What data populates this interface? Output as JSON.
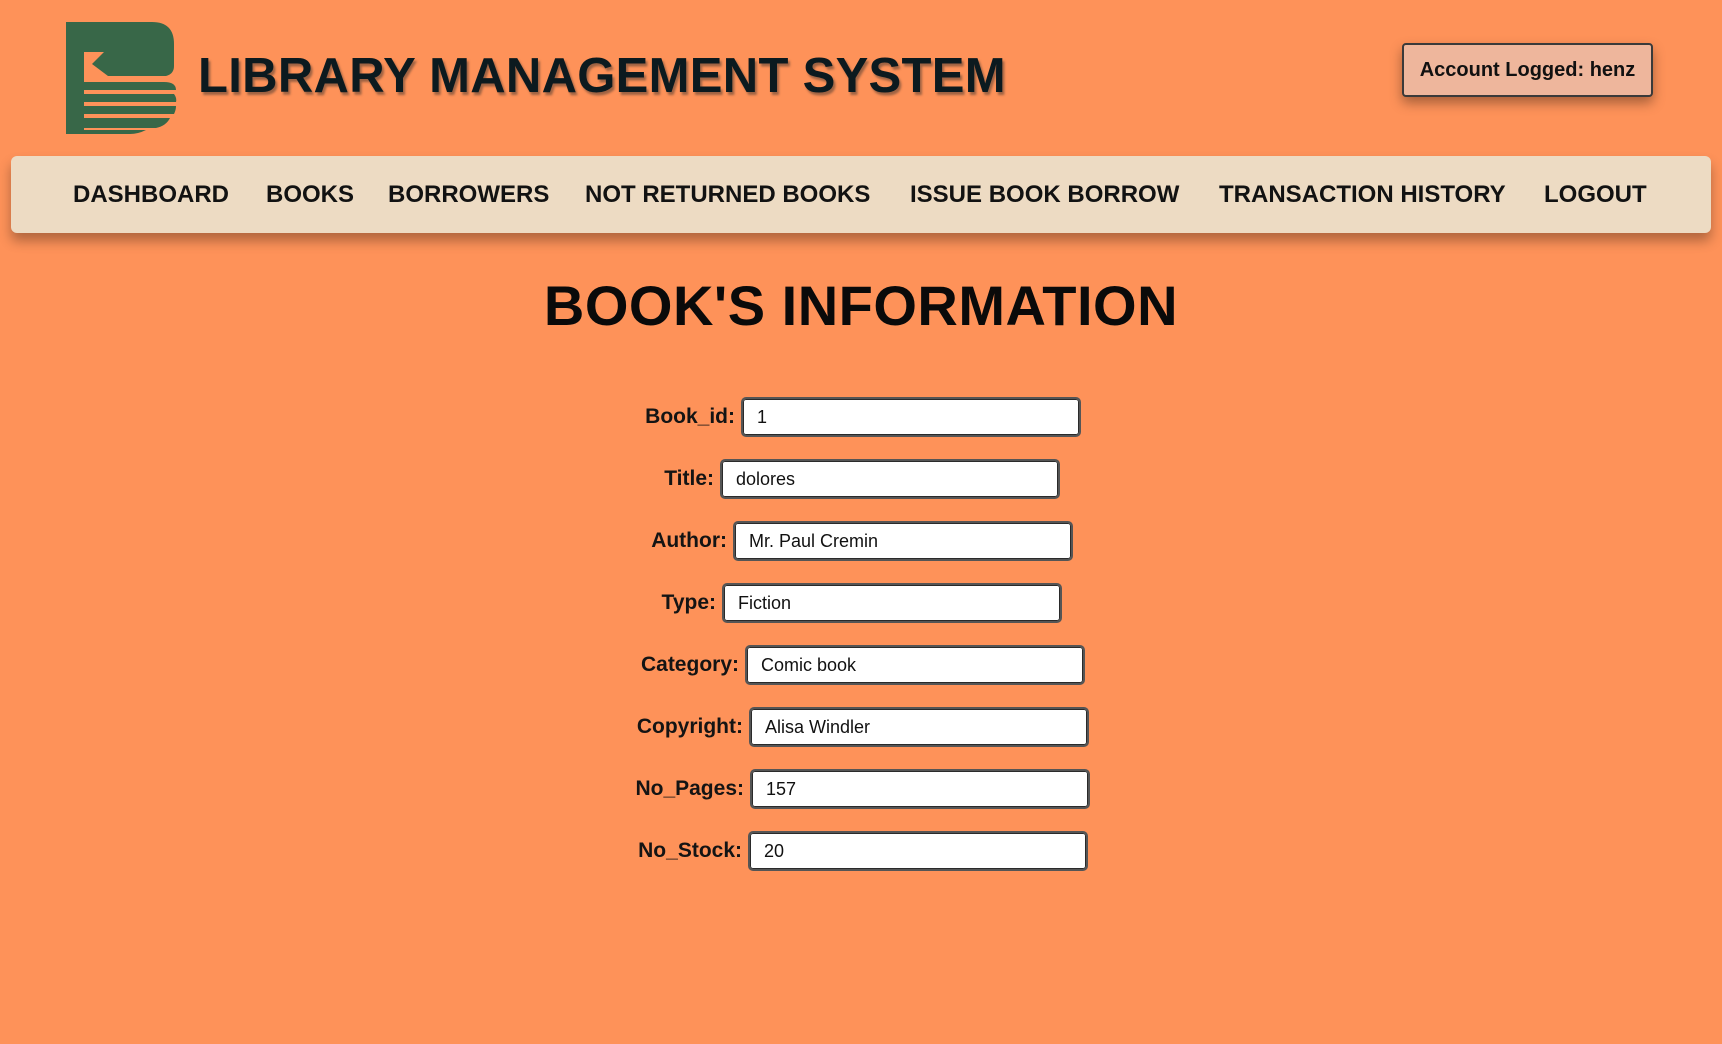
{
  "header": {
    "logo_icon": "book-stack-logo-icon",
    "title": "LIBRARY MANAGEMENT SYSTEM",
    "account_label": "Account Logged: henz"
  },
  "colors": {
    "background": "#fe9259",
    "navbar": "#eddbc3",
    "logo": "#386748",
    "account_badge": "#eeb69c"
  },
  "nav": {
    "items": [
      {
        "label": "DASHBOARD"
      },
      {
        "label": "BOOKS"
      },
      {
        "label": "BORROWERS"
      },
      {
        "label": "NOT RETURNED BOOKS"
      },
      {
        "label": "ISSUE BOOK BORROW"
      },
      {
        "label": "TRANSACTION HISTORY"
      },
      {
        "label": "LOGOUT"
      }
    ]
  },
  "page": {
    "title": "BOOK'S INFORMATION"
  },
  "form": {
    "fields": [
      {
        "label": "Book_id:",
        "value": "1"
      },
      {
        "label": "Title:",
        "value": "dolores"
      },
      {
        "label": "Author:",
        "value": "Mr. Paul Cremin"
      },
      {
        "label": "Type:",
        "value": "Fiction"
      },
      {
        "label": "Category:",
        "value": "Comic book"
      },
      {
        "label": "Copyright:",
        "value": "Alisa Windler"
      },
      {
        "label": "No_Pages:",
        "value": "157"
      },
      {
        "label": "No_Stock:",
        "value": "20"
      }
    ]
  }
}
